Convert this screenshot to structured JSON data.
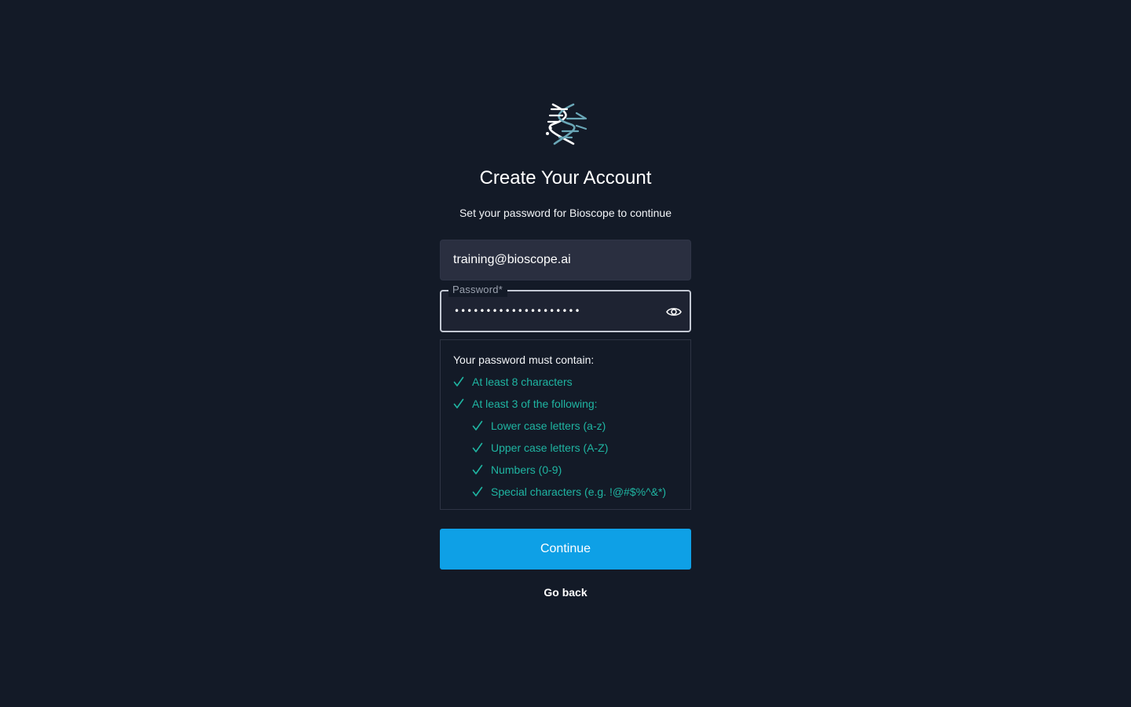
{
  "brand": {
    "logo_icon": "dna-helix-icon",
    "colors": {
      "background": "#131a27",
      "accent": "#0ea0e6",
      "success": "#1fb5a2",
      "logo_teal": "#6aa7b7"
    }
  },
  "header": {
    "title": "Create Your Account",
    "subtitle": "Set your password for Bioscope to continue"
  },
  "form": {
    "email_value": "training@bioscope.ai",
    "password_label": "Password",
    "password_required_marker": "*",
    "password_value": "••••••••••••••••••••",
    "toggle_visibility_icon": "eye-icon"
  },
  "requirements": {
    "title": "Your password must contain:",
    "items": [
      {
        "label": "At least 8 characters",
        "met": true,
        "level": 0
      },
      {
        "label": "At least 3 of the following:",
        "met": true,
        "level": 0
      },
      {
        "label": "Lower case letters (a-z)",
        "met": true,
        "level": 1
      },
      {
        "label": "Upper case letters (A-Z)",
        "met": true,
        "level": 1
      },
      {
        "label": "Numbers (0-9)",
        "met": true,
        "level": 1
      },
      {
        "label": "Special characters (e.g. !@#$%^&*)",
        "met": true,
        "level": 1
      }
    ],
    "check_icon": "check-icon"
  },
  "actions": {
    "continue_label": "Continue",
    "go_back_label": "Go back"
  }
}
